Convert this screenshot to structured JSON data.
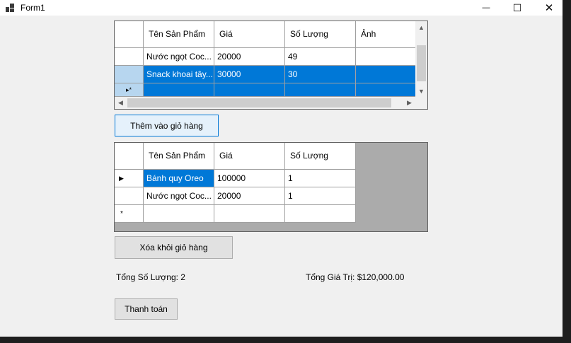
{
  "window": {
    "title": "Form1",
    "minimize_glyph": "—",
    "maximize_glyph": "☐",
    "close_glyph": "✕"
  },
  "products_grid": {
    "columns": [
      "Tên Sản Phẩm",
      "Giá",
      "Số Lượng",
      "Ảnh"
    ],
    "rows": [
      {
        "name": "Nước ngọt Coc...",
        "price": "20000",
        "qty": "49",
        "image": ""
      },
      {
        "name": "Snack khoai tây...",
        "price": "30000",
        "qty": "30",
        "image": ""
      }
    ],
    "new_row_marker": "▸*"
  },
  "add_to_cart_button": "Thêm vào giỏ hàng",
  "cart_grid": {
    "columns": [
      "Tên Sản Phẩm",
      "Giá",
      "Số Lượng"
    ],
    "rows": [
      {
        "name": "Bánh quy Oreo",
        "price": "100000",
        "qty": "1"
      },
      {
        "name": "Nước ngọt Coc...",
        "price": "20000",
        "qty": "1"
      }
    ],
    "current_row_marker": "▶",
    "new_row_marker": "*"
  },
  "remove_from_cart_button": "Xóa khỏi giỏ hàng",
  "total_quantity_label": "Tổng Số Lượng: 2",
  "total_value_label": "Tổng Giá Trị: $120,000.00",
  "checkout_button": "Thanh toán",
  "colors": {
    "selection": "#0078d7",
    "form_bg": "#f0f0f0",
    "grid_bg": "#ababab"
  }
}
